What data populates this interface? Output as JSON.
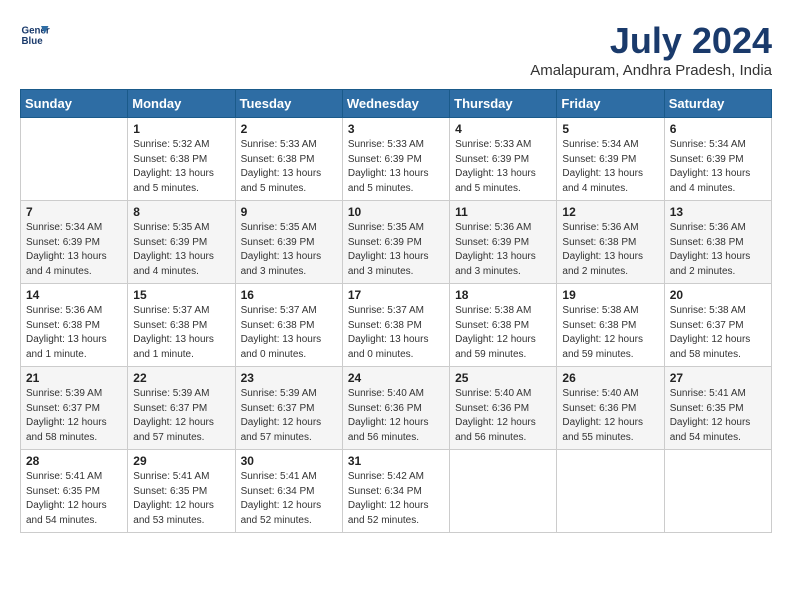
{
  "header": {
    "logo_line1": "General",
    "logo_line2": "Blue",
    "month_year": "July 2024",
    "location": "Amalapuram, Andhra Pradesh, India"
  },
  "weekdays": [
    "Sunday",
    "Monday",
    "Tuesday",
    "Wednesday",
    "Thursday",
    "Friday",
    "Saturday"
  ],
  "weeks": [
    [
      {
        "day": "",
        "info": ""
      },
      {
        "day": "1",
        "info": "Sunrise: 5:32 AM\nSunset: 6:38 PM\nDaylight: 13 hours\nand 5 minutes."
      },
      {
        "day": "2",
        "info": "Sunrise: 5:33 AM\nSunset: 6:38 PM\nDaylight: 13 hours\nand 5 minutes."
      },
      {
        "day": "3",
        "info": "Sunrise: 5:33 AM\nSunset: 6:39 PM\nDaylight: 13 hours\nand 5 minutes."
      },
      {
        "day": "4",
        "info": "Sunrise: 5:33 AM\nSunset: 6:39 PM\nDaylight: 13 hours\nand 5 minutes."
      },
      {
        "day": "5",
        "info": "Sunrise: 5:34 AM\nSunset: 6:39 PM\nDaylight: 13 hours\nand 4 minutes."
      },
      {
        "day": "6",
        "info": "Sunrise: 5:34 AM\nSunset: 6:39 PM\nDaylight: 13 hours\nand 4 minutes."
      }
    ],
    [
      {
        "day": "7",
        "info": "Sunrise: 5:34 AM\nSunset: 6:39 PM\nDaylight: 13 hours\nand 4 minutes."
      },
      {
        "day": "8",
        "info": "Sunrise: 5:35 AM\nSunset: 6:39 PM\nDaylight: 13 hours\nand 4 minutes."
      },
      {
        "day": "9",
        "info": "Sunrise: 5:35 AM\nSunset: 6:39 PM\nDaylight: 13 hours\nand 3 minutes."
      },
      {
        "day": "10",
        "info": "Sunrise: 5:35 AM\nSunset: 6:39 PM\nDaylight: 13 hours\nand 3 minutes."
      },
      {
        "day": "11",
        "info": "Sunrise: 5:36 AM\nSunset: 6:39 PM\nDaylight: 13 hours\nand 3 minutes."
      },
      {
        "day": "12",
        "info": "Sunrise: 5:36 AM\nSunset: 6:38 PM\nDaylight: 13 hours\nand 2 minutes."
      },
      {
        "day": "13",
        "info": "Sunrise: 5:36 AM\nSunset: 6:38 PM\nDaylight: 13 hours\nand 2 minutes."
      }
    ],
    [
      {
        "day": "14",
        "info": "Sunrise: 5:36 AM\nSunset: 6:38 PM\nDaylight: 13 hours\nand 1 minute."
      },
      {
        "day": "15",
        "info": "Sunrise: 5:37 AM\nSunset: 6:38 PM\nDaylight: 13 hours\nand 1 minute."
      },
      {
        "day": "16",
        "info": "Sunrise: 5:37 AM\nSunset: 6:38 PM\nDaylight: 13 hours\nand 0 minutes."
      },
      {
        "day": "17",
        "info": "Sunrise: 5:37 AM\nSunset: 6:38 PM\nDaylight: 13 hours\nand 0 minutes."
      },
      {
        "day": "18",
        "info": "Sunrise: 5:38 AM\nSunset: 6:38 PM\nDaylight: 12 hours\nand 59 minutes."
      },
      {
        "day": "19",
        "info": "Sunrise: 5:38 AM\nSunset: 6:38 PM\nDaylight: 12 hours\nand 59 minutes."
      },
      {
        "day": "20",
        "info": "Sunrise: 5:38 AM\nSunset: 6:37 PM\nDaylight: 12 hours\nand 58 minutes."
      }
    ],
    [
      {
        "day": "21",
        "info": "Sunrise: 5:39 AM\nSunset: 6:37 PM\nDaylight: 12 hours\nand 58 minutes."
      },
      {
        "day": "22",
        "info": "Sunrise: 5:39 AM\nSunset: 6:37 PM\nDaylight: 12 hours\nand 57 minutes."
      },
      {
        "day": "23",
        "info": "Sunrise: 5:39 AM\nSunset: 6:37 PM\nDaylight: 12 hours\nand 57 minutes."
      },
      {
        "day": "24",
        "info": "Sunrise: 5:40 AM\nSunset: 6:36 PM\nDaylight: 12 hours\nand 56 minutes."
      },
      {
        "day": "25",
        "info": "Sunrise: 5:40 AM\nSunset: 6:36 PM\nDaylight: 12 hours\nand 56 minutes."
      },
      {
        "day": "26",
        "info": "Sunrise: 5:40 AM\nSunset: 6:36 PM\nDaylight: 12 hours\nand 55 minutes."
      },
      {
        "day": "27",
        "info": "Sunrise: 5:41 AM\nSunset: 6:35 PM\nDaylight: 12 hours\nand 54 minutes."
      }
    ],
    [
      {
        "day": "28",
        "info": "Sunrise: 5:41 AM\nSunset: 6:35 PM\nDaylight: 12 hours\nand 54 minutes."
      },
      {
        "day": "29",
        "info": "Sunrise: 5:41 AM\nSunset: 6:35 PM\nDaylight: 12 hours\nand 53 minutes."
      },
      {
        "day": "30",
        "info": "Sunrise: 5:41 AM\nSunset: 6:34 PM\nDaylight: 12 hours\nand 52 minutes."
      },
      {
        "day": "31",
        "info": "Sunrise: 5:42 AM\nSunset: 6:34 PM\nDaylight: 12 hours\nand 52 minutes."
      },
      {
        "day": "",
        "info": ""
      },
      {
        "day": "",
        "info": ""
      },
      {
        "day": "",
        "info": ""
      }
    ]
  ]
}
